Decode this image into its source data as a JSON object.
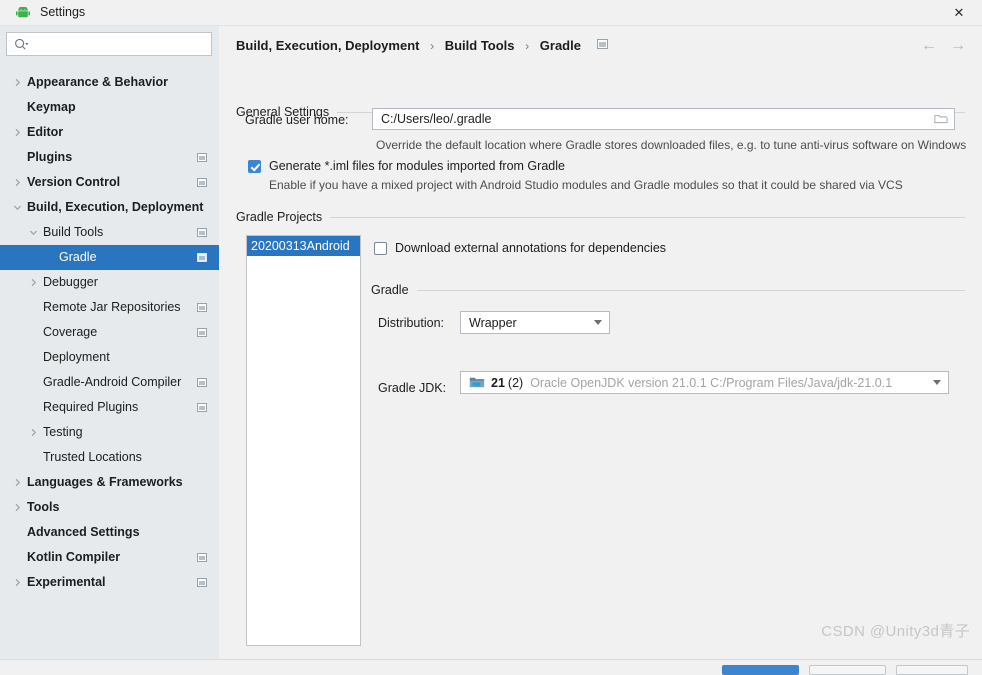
{
  "window": {
    "title": "Settings",
    "app_icon": "android-robot-icon",
    "close_label": "✕"
  },
  "sidebar": {
    "search": {
      "placeholder": "",
      "value": "",
      "icon": "search-icon"
    },
    "items": [
      {
        "label": "Appearance & Behavior",
        "indent": 0,
        "twisty": "collapsed",
        "bold": true,
        "badge": false,
        "selected": false
      },
      {
        "label": "Keymap",
        "indent": 0,
        "twisty": "none",
        "bold": true,
        "badge": false,
        "selected": false
      },
      {
        "label": "Editor",
        "indent": 0,
        "twisty": "collapsed",
        "bold": true,
        "badge": false,
        "selected": false
      },
      {
        "label": "Plugins",
        "indent": 0,
        "twisty": "none",
        "bold": true,
        "badge": true,
        "selected": false
      },
      {
        "label": "Version Control",
        "indent": 0,
        "twisty": "collapsed",
        "bold": true,
        "badge": true,
        "selected": false
      },
      {
        "label": "Build, Execution, Deployment",
        "indent": 0,
        "twisty": "expanded",
        "bold": true,
        "badge": false,
        "selected": false
      },
      {
        "label": "Build Tools",
        "indent": 1,
        "twisty": "expanded",
        "bold": false,
        "badge": true,
        "selected": false
      },
      {
        "label": "Gradle",
        "indent": 2,
        "twisty": "none",
        "bold": false,
        "badge": true,
        "selected": true
      },
      {
        "label": "Debugger",
        "indent": 1,
        "twisty": "collapsed",
        "bold": false,
        "badge": false,
        "selected": false
      },
      {
        "label": "Remote Jar Repositories",
        "indent": 1,
        "twisty": "none",
        "bold": false,
        "badge": true,
        "selected": false
      },
      {
        "label": "Coverage",
        "indent": 1,
        "twisty": "none",
        "bold": false,
        "badge": true,
        "selected": false
      },
      {
        "label": "Deployment",
        "indent": 1,
        "twisty": "none",
        "bold": false,
        "badge": false,
        "selected": false
      },
      {
        "label": "Gradle-Android Compiler",
        "indent": 1,
        "twisty": "none",
        "bold": false,
        "badge": true,
        "selected": false
      },
      {
        "label": "Required Plugins",
        "indent": 1,
        "twisty": "none",
        "bold": false,
        "badge": true,
        "selected": false
      },
      {
        "label": "Testing",
        "indent": 1,
        "twisty": "collapsed",
        "bold": false,
        "badge": false,
        "selected": false
      },
      {
        "label": "Trusted Locations",
        "indent": 1,
        "twisty": "none",
        "bold": false,
        "badge": false,
        "selected": false
      },
      {
        "label": "Languages & Frameworks",
        "indent": 0,
        "twisty": "collapsed",
        "bold": true,
        "badge": false,
        "selected": false
      },
      {
        "label": "Tools",
        "indent": 0,
        "twisty": "collapsed",
        "bold": true,
        "badge": false,
        "selected": false
      },
      {
        "label": "Advanced Settings",
        "indent": 0,
        "twisty": "none",
        "bold": true,
        "badge": false,
        "selected": false
      },
      {
        "label": "Kotlin Compiler",
        "indent": 0,
        "twisty": "none",
        "bold": true,
        "badge": true,
        "selected": false
      },
      {
        "label": "Experimental",
        "indent": 0,
        "twisty": "collapsed",
        "bold": true,
        "badge": true,
        "selected": false
      }
    ]
  },
  "breadcrumb": {
    "part1": "Build, Execution, Deployment",
    "sep1": "›",
    "part2": "Build Tools",
    "sep2": "›",
    "part3": "Gradle",
    "badge": "settings-sync-badge-icon"
  },
  "nav": {
    "back": "←",
    "forward": "→"
  },
  "general_settings": {
    "section_label": "General Settings",
    "gradle_user_home_label": "Gradle user home:",
    "gradle_user_home_value": "C:/Users/leo/.gradle",
    "gradle_user_home_placeholder": "",
    "gradle_user_home_hint": "Override the default location where Gradle stores downloaded files, e.g. to tune anti-virus software on Windows",
    "generate_iml_label": "Generate *.iml files for modules imported from Gradle",
    "generate_iml_checked": true,
    "generate_iml_hint": "Enable if you have a mixed project with Android Studio modules and Gradle modules so that it could be shared via VCS"
  },
  "gradle_projects": {
    "section_label": "Gradle Projects",
    "projects": [
      {
        "name": "20200313Android",
        "selected": true
      }
    ],
    "download_annotations_label": "Download external annotations for dependencies",
    "download_annotations_checked": false
  },
  "gradle": {
    "section_label": "Gradle",
    "distribution_label": "Distribution:",
    "distribution_value": "Wrapper",
    "jdk_label": "Gradle JDK:",
    "jdk_icon": "jdk-folder-icon",
    "jdk_version": "21",
    "jdk_count": "(2)",
    "jdk_path": "Oracle OpenJDK version 21.0.1 C:/Program Files/Java/jdk-21.0.1"
  },
  "watermark": "CSDN @Unity3d青子",
  "colors": {
    "selection_blue": "#2a75c0",
    "checkbox_blue": "#3d85d0",
    "sidebar_bg": "#e6eaed",
    "panel_bg": "#f1f1f1",
    "hint_text": "#4d4d4d",
    "muted_path": "#a4a4a4"
  }
}
